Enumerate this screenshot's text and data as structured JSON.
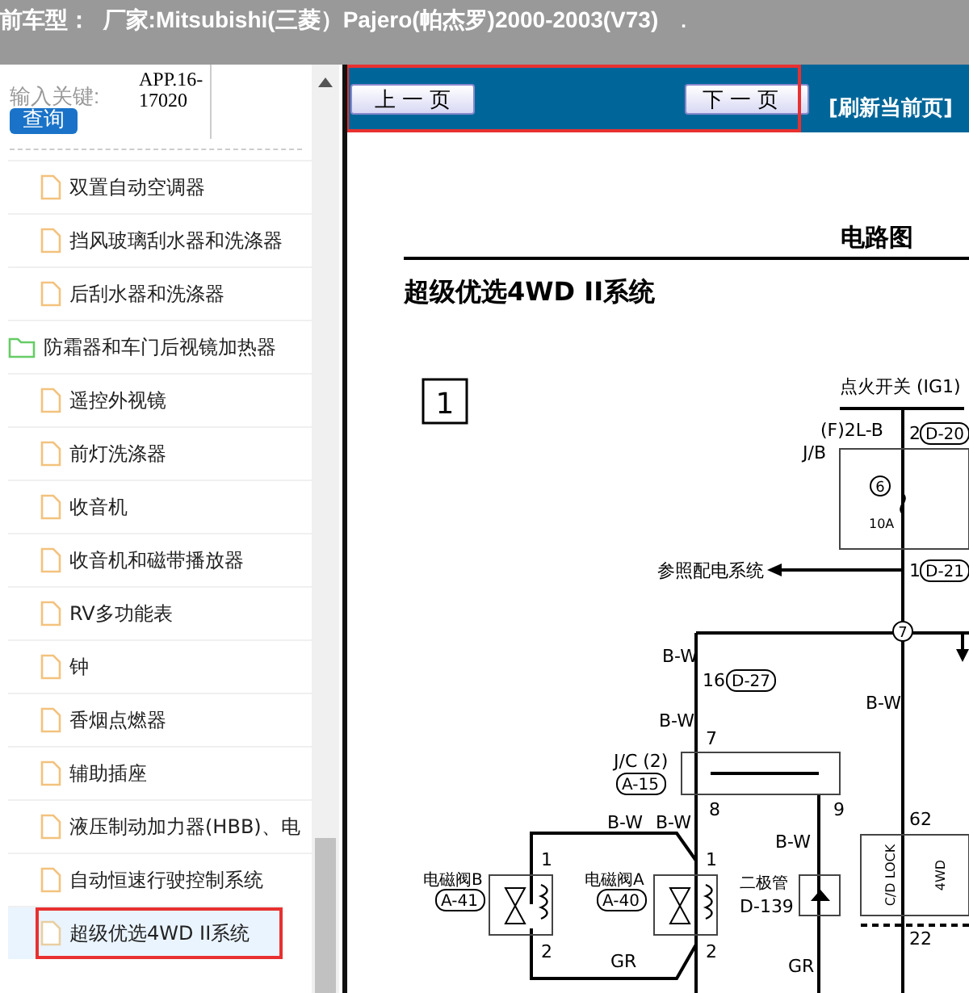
{
  "header": {
    "title": "前车型：  厂家:Mitsubishi(三菱）Pajero(帕杰罗)2000-2003(V73)",
    "mark": "."
  },
  "search": {
    "label": "输入关键:",
    "value": "APP.16-17020",
    "button": "查询"
  },
  "tree": [
    {
      "kind": "file",
      "label": "双置自动空调器",
      "selected": false,
      "highlighted": false
    },
    {
      "kind": "file",
      "label": "挡风玻璃刮水器和洗涤器",
      "selected": false,
      "highlighted": false
    },
    {
      "kind": "file",
      "label": "后刮水器和洗涤器",
      "selected": false,
      "highlighted": false
    },
    {
      "kind": "folder",
      "label": "防霜器和车门后视镜加热器",
      "selected": false,
      "highlighted": false
    },
    {
      "kind": "file",
      "label": "遥控外视镜",
      "selected": false,
      "highlighted": false
    },
    {
      "kind": "file",
      "label": "前灯洗涤器",
      "selected": false,
      "highlighted": false
    },
    {
      "kind": "file",
      "label": "收音机",
      "selected": false,
      "highlighted": false
    },
    {
      "kind": "file",
      "label": "收音机和磁带播放器",
      "selected": false,
      "highlighted": false
    },
    {
      "kind": "file",
      "label": "RV多功能表",
      "selected": false,
      "highlighted": false
    },
    {
      "kind": "file",
      "label": "钟",
      "selected": false,
      "highlighted": false
    },
    {
      "kind": "file",
      "label": "香烟点燃器",
      "selected": false,
      "highlighted": false
    },
    {
      "kind": "file",
      "label": "辅助插座",
      "selected": false,
      "highlighted": false
    },
    {
      "kind": "file",
      "label": "液压制动加力器(HBB)、电",
      "selected": false,
      "highlighted": false
    },
    {
      "kind": "file",
      "label": "自动恒速行驶控制系统",
      "selected": false,
      "highlighted": false
    },
    {
      "kind": "file",
      "label": "超级优选4WD II系统",
      "selected": true,
      "highlighted": true
    }
  ],
  "nav": {
    "prev": "上一页",
    "next": "下一页",
    "refresh": "[刷新当前页]",
    "highlighted": true
  },
  "diagram": {
    "heading": "电路图",
    "title": "超级优选4WD II系统",
    "section": "1",
    "labels": [
      {
        "text": "点火开关 (IG1)"
      },
      {
        "text": "(F)2L-B"
      },
      {
        "text": "2"
      },
      {
        "text": "D-20"
      },
      {
        "text": "J/B"
      },
      {
        "text": "6"
      },
      {
        "text": "10A"
      },
      {
        "text": "参照配电系统"
      },
      {
        "text": "1"
      },
      {
        "text": "D-21"
      },
      {
        "text": "7"
      },
      {
        "text": "B-W"
      },
      {
        "text": "16"
      },
      {
        "text": "D-27"
      },
      {
        "text": "B-W"
      },
      {
        "text": "7"
      },
      {
        "text": "J/C (2)"
      },
      {
        "text": "A-15"
      },
      {
        "text": "8"
      },
      {
        "text": "9"
      },
      {
        "text": "B-W"
      },
      {
        "text": "B-W"
      },
      {
        "text": "B-W"
      },
      {
        "text": "B-W"
      },
      {
        "text": "1"
      },
      {
        "text": "1"
      },
      {
        "text": "电磁阀B"
      },
      {
        "text": "A-41"
      },
      {
        "text": "电磁阀A"
      },
      {
        "text": "A-40"
      },
      {
        "text": "二极管"
      },
      {
        "text": "D-139"
      },
      {
        "text": "2"
      },
      {
        "text": "2"
      },
      {
        "text": "GR"
      },
      {
        "text": "GR"
      },
      {
        "text": "62"
      },
      {
        "text": "C/D LOCK"
      },
      {
        "text": "4WD"
      },
      {
        "text": "22"
      }
    ]
  }
}
